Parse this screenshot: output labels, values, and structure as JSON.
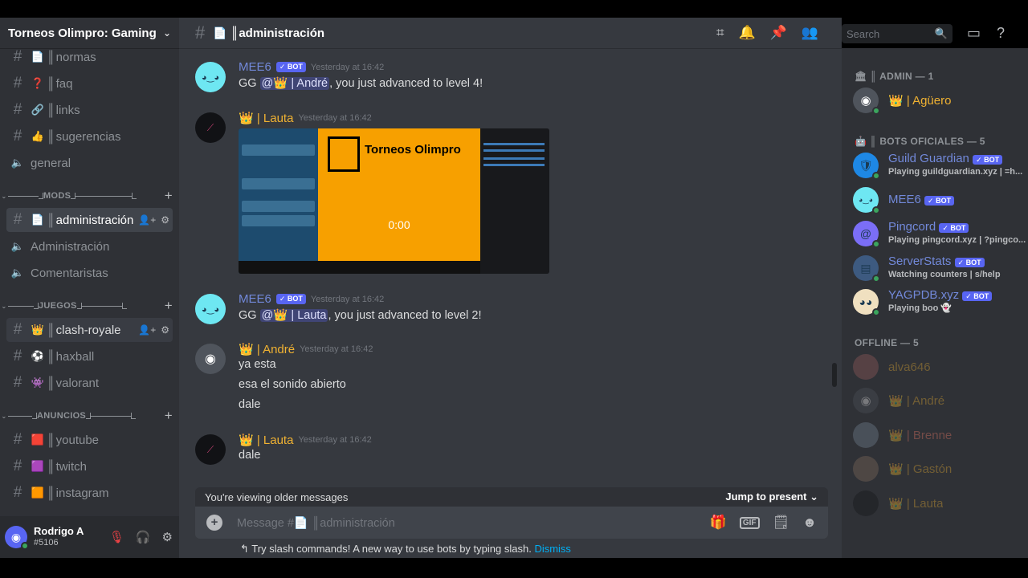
{
  "guild": {
    "name": "Torneos Olimpro: Gaming"
  },
  "channels": [
    {
      "emoji": "📄",
      "name": "normas",
      "state": ""
    },
    {
      "emoji": "❓",
      "name": "faq",
      "state": ""
    },
    {
      "emoji": "🔗",
      "name": "links",
      "state": ""
    },
    {
      "emoji": "👍",
      "name": "sugerencias",
      "state": ""
    },
    {
      "emoji": "",
      "name": "general",
      "state": "voice"
    },
    {
      "emoji": "📄",
      "name": "administración",
      "state": "active"
    },
    {
      "emoji": "",
      "name": "Administración",
      "state": "voice"
    },
    {
      "emoji": "",
      "name": "Comentaristas",
      "state": "voice"
    },
    {
      "emoji": "👑",
      "name": "clash-royale",
      "state": "hover"
    },
    {
      "emoji": "⚽",
      "name": "haxball",
      "state": ""
    },
    {
      "emoji": "👾",
      "name": "valorant",
      "state": ""
    },
    {
      "emoji": "🟥",
      "name": "youtube",
      "state": ""
    },
    {
      "emoji": "🟪",
      "name": "twitch",
      "state": ""
    },
    {
      "emoji": "🟧",
      "name": "instagram",
      "state": ""
    }
  ],
  "categories": [
    "MODS",
    "JUEGOS",
    "ANUNCIOS"
  ],
  "user": {
    "name": "Rodrigo A",
    "tag": "#5106"
  },
  "header": {
    "channel": "administración",
    "search_placeholder": "Search"
  },
  "messages": [
    {
      "author": "MEE6",
      "bot": "✓ BOT",
      "time": "Yesterday at 16:42",
      "pre": "GG ",
      "mention": "@👑 | André",
      "post": ", you just advanced to level 4!"
    },
    {
      "author": "👑 | Lauta",
      "time": "Yesterday at 16:42",
      "embed": {
        "brand": "Torneos Olimpro",
        "duration": "0:00"
      }
    },
    {
      "author": "MEE6",
      "bot": "✓ BOT",
      "time": "Yesterday at 16:42",
      "pre": "GG ",
      "mention": "@👑 | Lauta",
      "post": ", you just advanced to level 2!"
    },
    {
      "author": "👑 | André",
      "time": "Yesterday at 16:42",
      "lines": [
        "ya esta",
        "esa el sonido abierto",
        "dale"
      ]
    },
    {
      "author": "👑 | Lauta",
      "time": "Yesterday at 16:42",
      "lines": [
        "dale"
      ]
    }
  ],
  "older_bar": {
    "text": "You're viewing older messages",
    "jump": "Jump to present"
  },
  "composer": {
    "placeholder": "Message #📄 ║administración"
  },
  "hint": {
    "text": "Try slash commands! A new way to use bots by typing slash.",
    "dismiss": "Dismiss"
  },
  "members": {
    "admin_header": "ADMIN — 1",
    "admin": [
      {
        "name": "👑 | Agüero",
        "color": "#f0b232"
      }
    ],
    "bots_header": "BOTS OFICIALES — 5",
    "bots": [
      {
        "name": "Guild Guardian",
        "status": "Playing guildguardian.xyz | =h...",
        "bg": "#1e88e5"
      },
      {
        "name": "MEE6",
        "status": "",
        "bg": "#6ee7f2"
      },
      {
        "name": "Pingcord",
        "status": "Playing pingcord.xyz | ?pingco...",
        "bg": "#7b6ef6"
      },
      {
        "name": "ServerStats",
        "status": "Watching counters | s/help",
        "bg": "#3d5a80"
      },
      {
        "name": "YAGPDB.xyz",
        "status": "Playing boo 👻",
        "bg": "#f0e0c0"
      }
    ],
    "offline_header": "OFFLINE — 5",
    "offline": [
      {
        "name": "alva646",
        "color": "#f0b232",
        "bg": "#a06060"
      },
      {
        "name": "👑 | André",
        "color": "#f0b232",
        "bg": "#4f545c"
      },
      {
        "name": "👑 | Brenne",
        "color": "#f47b67",
        "bg": "#7a8a9a"
      },
      {
        "name": "👑 | Gastón",
        "color": "#f0b232",
        "bg": "#8a7060"
      },
      {
        "name": "👑 | Lauta",
        "color": "#f0b232",
        "bg": "#111215"
      }
    ]
  }
}
